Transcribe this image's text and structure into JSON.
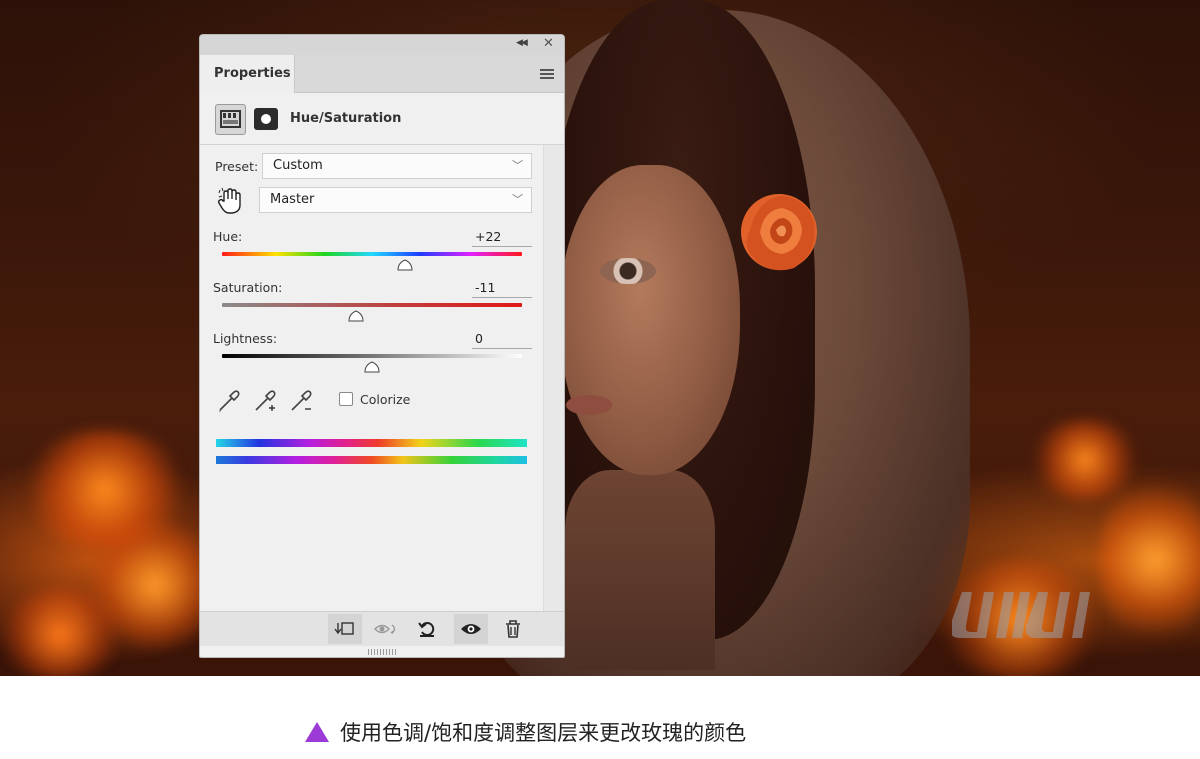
{
  "panel": {
    "tab_label": "Properties",
    "adjustment_title": "Hue/Saturation",
    "preset_label": "Preset:",
    "preset_value": "Custom",
    "channel_value": "Master",
    "hue": {
      "label": "Hue:",
      "value": "+22",
      "level": 0.61
    },
    "saturation": {
      "label": "Saturation:",
      "value": "-11",
      "level": 0.445
    },
    "lightness": {
      "label": "Lightness:",
      "value": "0",
      "level": 0.5
    },
    "colorize_label": "Colorize",
    "colorize_checked": false,
    "icons": {
      "collapse": "double-chevron-left-icon",
      "close": "close-icon",
      "menu": "panel-menu-icon",
      "adjustment": "hue-saturation-adjustment-icon",
      "mask": "layer-mask-icon",
      "targeted": "targeted-adjustment-hand-icon",
      "eyedroppers": [
        "eyedropper-icon",
        "eyedropper-plus-icon",
        "eyedropper-minus-icon"
      ],
      "bottom": [
        "clip-to-layer-icon",
        "view-previous-state-icon",
        "reset-icon",
        "toggle-visibility-icon",
        "delete-icon"
      ]
    }
  },
  "caption": {
    "text": "使用色调/饱和度调整图层来更改玫瑰的颜色",
    "icon_color": "#9b3ad6"
  },
  "watermark": "UiiiUiii",
  "colors": {
    "panel_bg": "#f0f0f0",
    "accent_purple": "#9b3ad6"
  }
}
